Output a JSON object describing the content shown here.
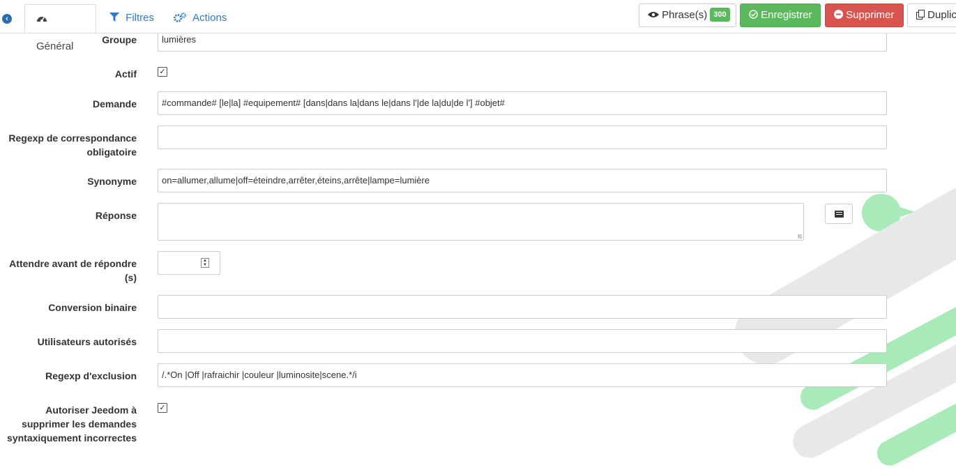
{
  "tabs": [
    {
      "label": "Général",
      "icon": "dashboard-icon",
      "active": true
    },
    {
      "label": "Filtres",
      "icon": "filter-icon",
      "active": false
    },
    {
      "label": "Actions",
      "icon": "cogs-icon",
      "active": false
    }
  ],
  "toolbar": {
    "phrases_label": "Phrase(s)",
    "phrases_count": "300",
    "save_label": "Enregistrer",
    "delete_label": "Supprimer",
    "duplicate_label": "Duplic"
  },
  "form": {
    "groupe": {
      "label": "Groupe",
      "value": "lumières"
    },
    "actif": {
      "label": "Actif",
      "checked": true
    },
    "demande": {
      "label": "Demande",
      "value": "#commande# [le|la] #equipement# [dans|dans la|dans le|dans l'|de la|du|de l'] #objet#"
    },
    "regexp_corr": {
      "label_line1": "Regexp de correspondance",
      "label_line2": "obligatoire",
      "value": ""
    },
    "synonyme": {
      "label": "Synonyme",
      "value": "on=allumer,allume|off=éteindre,arrêter,éteins,arrête|lampe=lumière"
    },
    "reponse": {
      "label": "Réponse",
      "value": ""
    },
    "attendre": {
      "label_line1": "Attendre avant de répondre",
      "label_line2": "(s)",
      "value": ""
    },
    "conversion": {
      "label": "Conversion binaire",
      "value": ""
    },
    "utilisateurs": {
      "label": "Utilisateurs autorisés",
      "value": ""
    },
    "regexp_excl": {
      "label": "Regexp d'exclusion",
      "value": "/.*On |Off |rafraichir |couleur |luminosite|scene.*/i"
    },
    "autoriser": {
      "label_line1": "Autoriser Jeedom à",
      "label_line2": "supprimer les demandes",
      "label_line3": "syntaxiquement incorrectes",
      "checked": true
    }
  },
  "colors": {
    "link": "#3079c6",
    "success": "#5cb85c",
    "danger": "#d9534f",
    "decor_green": "#a8ebb8",
    "decor_gray": "#e8e8e8"
  }
}
